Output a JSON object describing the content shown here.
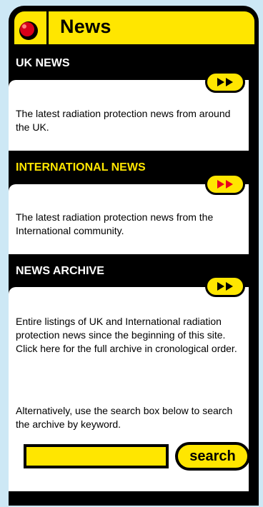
{
  "header": {
    "title": "News",
    "icon": "red-ball-icon"
  },
  "sections": [
    {
      "title": "UK NEWS",
      "text": "The latest radiation protection news from around the UK.",
      "title_color": "#ffffff"
    },
    {
      "title": "INTERNATIONAL NEWS",
      "text": "The latest radiation protection news from the International community.",
      "title_color": "#ffe600"
    },
    {
      "title": "NEWS ARCHIVE",
      "text": "Entire listings of UK and International radiation protection news since the beginning of this site. Click here for the full archive in cronological order.",
      "title_color": "#ffffff"
    }
  ],
  "archive_note": "Alternatively, use the search box below to search the archive by keyword.",
  "search": {
    "value": "",
    "button_label": "search"
  },
  "colors": {
    "accent": "#ffe600",
    "panel": "#000000",
    "page_bg": "#cde8f5",
    "arrow_uk": "#000000",
    "arrow_international": "#e8001c",
    "arrow_archive": "#000000"
  }
}
